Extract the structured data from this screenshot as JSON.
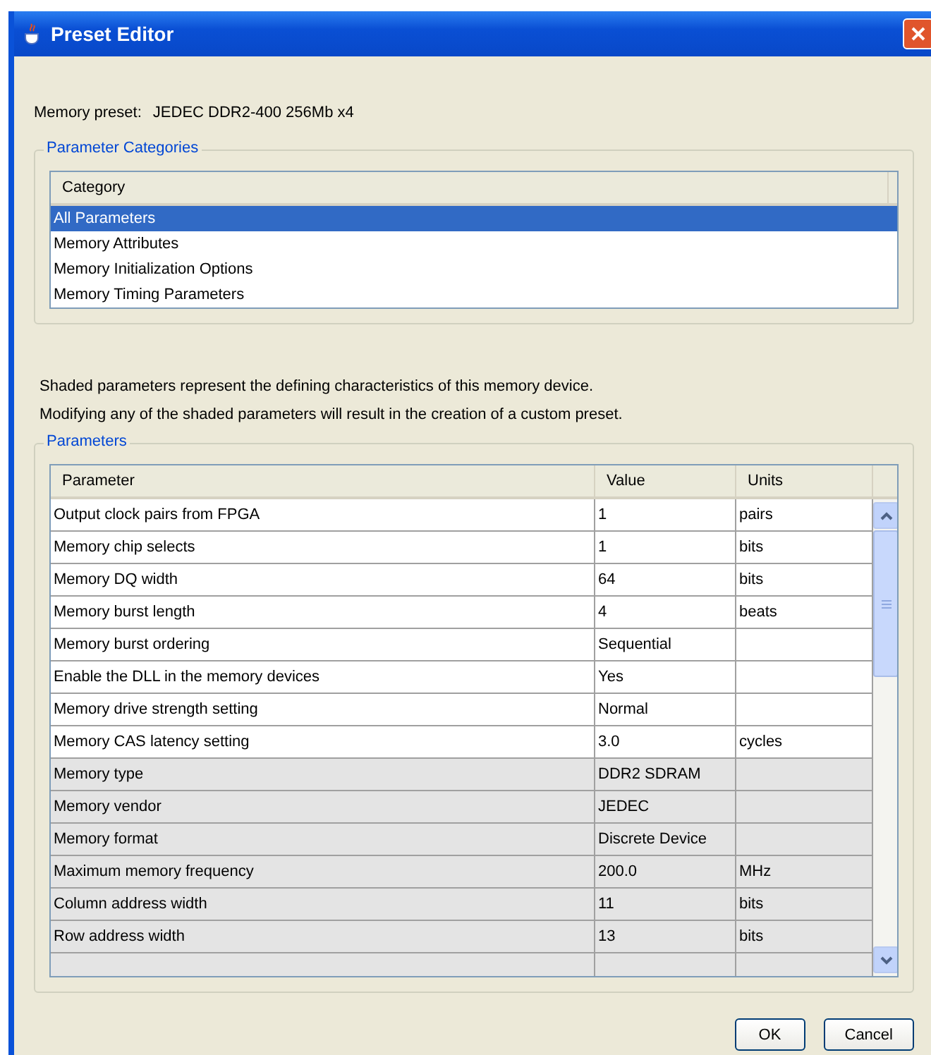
{
  "window": {
    "title": "Preset Editor"
  },
  "memory_preset": {
    "label": "Memory preset:",
    "value": "JEDEC DDR2-400 256Mb x4"
  },
  "categories": {
    "title": "Parameter Categories",
    "column": "Category",
    "items": [
      {
        "label": "All Parameters",
        "selected": true
      },
      {
        "label": "Memory Attributes",
        "selected": false
      },
      {
        "label": "Memory Initialization Options",
        "selected": false
      },
      {
        "label": "Memory Timing Parameters",
        "selected": false
      }
    ]
  },
  "notes": [
    "Shaded parameters represent the defining characteristics of this memory device.",
    "Modifying any of the shaded parameters will result in the creation of a custom preset."
  ],
  "parameters": {
    "title": "Parameters",
    "columns": [
      "Parameter",
      "Value",
      "Units"
    ],
    "rows": [
      {
        "parameter": "Output clock pairs from FPGA",
        "value": "1",
        "units": "pairs",
        "shaded": false
      },
      {
        "parameter": "Memory chip selects",
        "value": "1",
        "units": "bits",
        "shaded": false
      },
      {
        "parameter": "Memory DQ width",
        "value": "64",
        "units": "bits",
        "shaded": false
      },
      {
        "parameter": "Memory burst length",
        "value": "4",
        "units": "beats",
        "shaded": false
      },
      {
        "parameter": "Memory burst ordering",
        "value": "Sequential",
        "units": "",
        "shaded": false
      },
      {
        "parameter": "Enable the DLL in the memory devices",
        "value": "Yes",
        "units": "",
        "shaded": false
      },
      {
        "parameter": "Memory drive strength setting",
        "value": "Normal",
        "units": "",
        "shaded": false
      },
      {
        "parameter": "Memory CAS latency setting",
        "value": "3.0",
        "units": "cycles",
        "shaded": false
      },
      {
        "parameter": "Memory type",
        "value": "DDR2 SDRAM",
        "units": "",
        "shaded": true
      },
      {
        "parameter": "Memory vendor",
        "value": "JEDEC",
        "units": "",
        "shaded": true
      },
      {
        "parameter": "Memory format",
        "value": "Discrete Device",
        "units": "",
        "shaded": true
      },
      {
        "parameter": "Maximum memory frequency",
        "value": "200.0",
        "units": "MHz",
        "shaded": true
      },
      {
        "parameter": "Column address width",
        "value": "11",
        "units": "bits",
        "shaded": true
      },
      {
        "parameter": "Row address width",
        "value": "13",
        "units": "bits",
        "shaded": true
      }
    ]
  },
  "buttons": [
    "OK",
    "Cancel"
  ]
}
